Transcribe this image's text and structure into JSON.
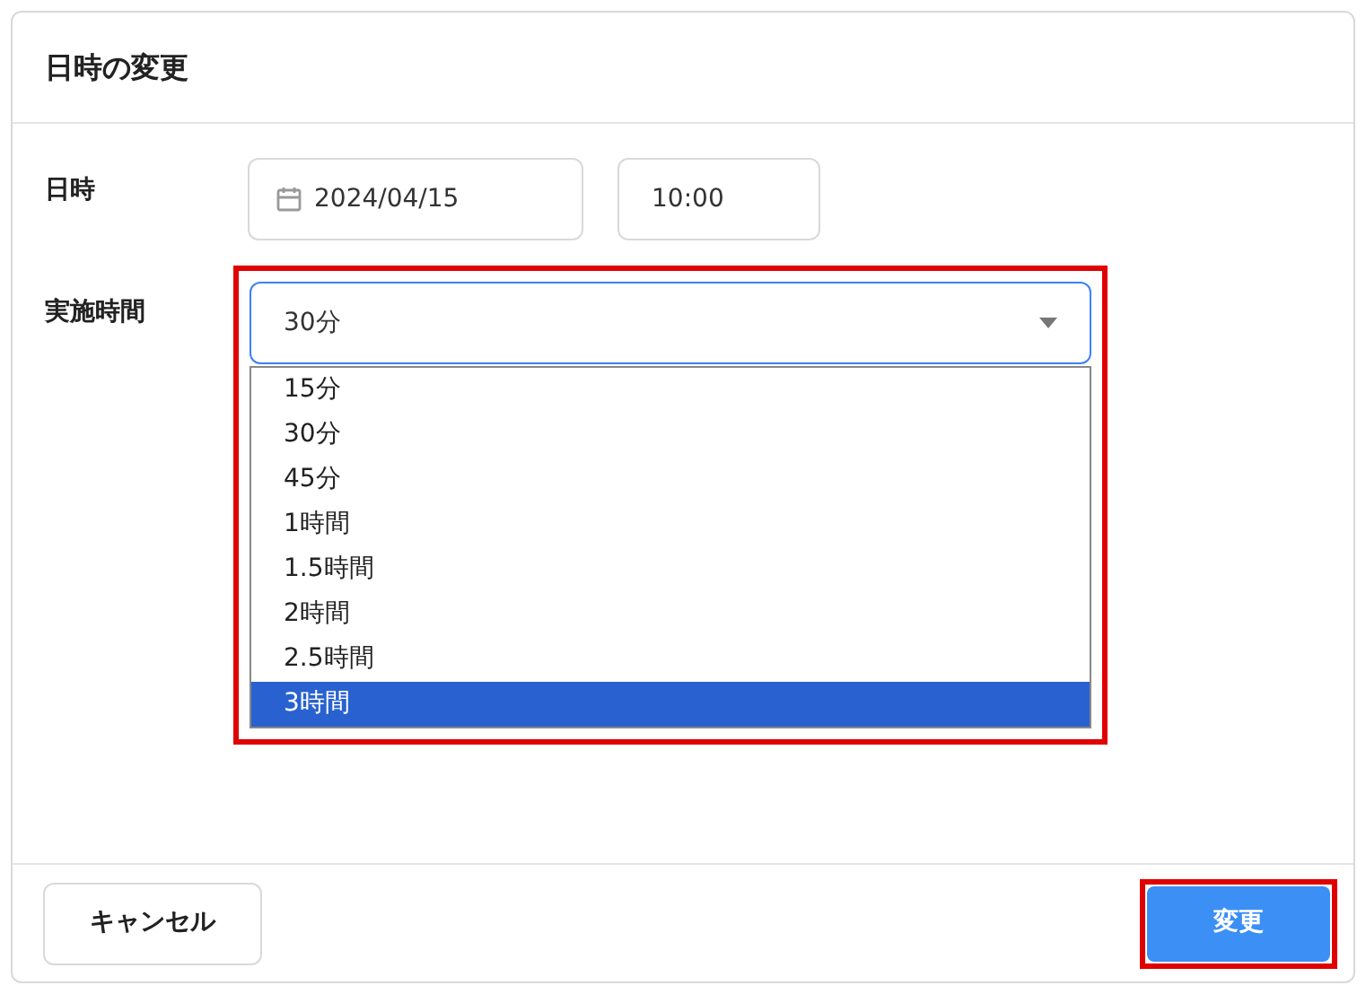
{
  "dialog": {
    "title": "日時の変更"
  },
  "datetime": {
    "label": "日時",
    "date": "2024/04/15",
    "time": "10:00"
  },
  "duration": {
    "label": "実施時間",
    "value": "30分",
    "highlighted": true,
    "expanded": true,
    "options": [
      {
        "label": "15分",
        "highlighted": false
      },
      {
        "label": "30分",
        "highlighted": false
      },
      {
        "label": "45分",
        "highlighted": false
      },
      {
        "label": "1時間",
        "highlighted": false
      },
      {
        "label": "1.5時間",
        "highlighted": false
      },
      {
        "label": "2時間",
        "highlighted": false
      },
      {
        "label": "2.5時間",
        "highlighted": false
      },
      {
        "label": "3時間",
        "highlighted": true
      }
    ]
  },
  "buttons": [
    {
      "kind": "secondary",
      "label": "キャンセル",
      "highlighted": false
    },
    {
      "kind": "primary",
      "label": "変更",
      "highlighted": true
    }
  ]
}
